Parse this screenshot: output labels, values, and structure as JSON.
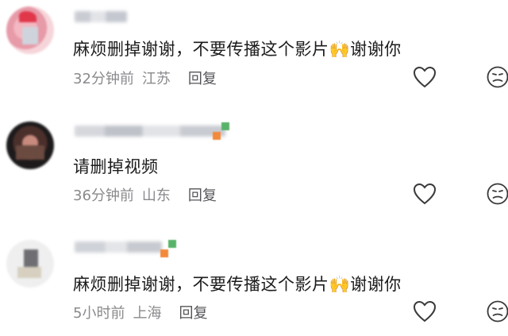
{
  "comments": [
    {
      "text": "麻烦删掉谢谢，不要传播这个影片🙌谢谢你",
      "time": "32分钟前",
      "location": "江苏",
      "reply_label": "回复"
    },
    {
      "text": "请删掉视频",
      "time": "36分钟前",
      "location": "山东",
      "reply_label": "回复"
    },
    {
      "text": "麻烦删掉谢谢，不要传播这个影片🙌谢谢你",
      "time": "5小时前",
      "location": "上海",
      "reply_label": "回复"
    }
  ],
  "icons": {
    "like": "heart-outline-icon",
    "dislike": "frown-face-icon"
  },
  "colors": {
    "text": "#1c1c1e",
    "meta": "#8a8a8e",
    "icon_stroke": "#3a3a3c"
  }
}
